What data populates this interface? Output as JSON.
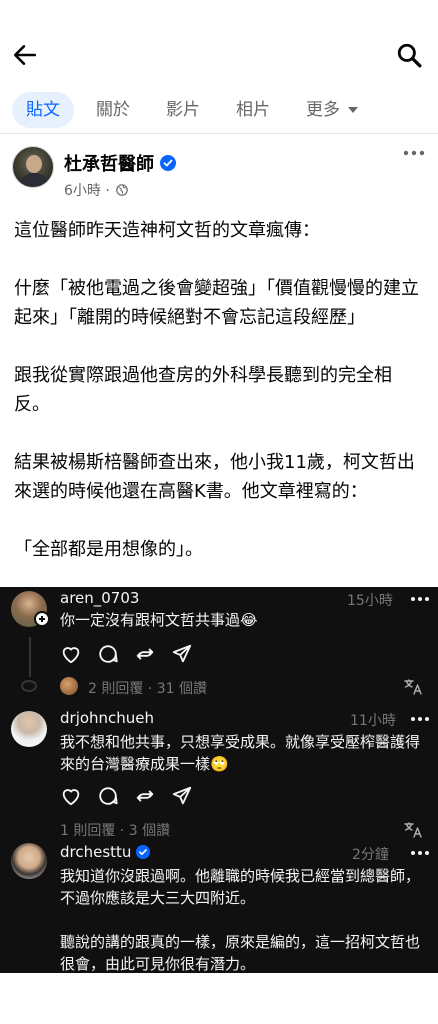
{
  "tabs": [
    {
      "label": "貼文"
    },
    {
      "label": "關於"
    },
    {
      "label": "影片"
    },
    {
      "label": "相片"
    },
    {
      "label": "更多"
    }
  ],
  "post": {
    "author": "杜承哲醫師",
    "time": "6小時 ·",
    "paragraphs": [
      "這位醫師昨天造神柯文哲的文章瘋傳：",
      "什麼「被他電過之後會變超強」「價值觀慢慢的建立起來」「離開的時候絕對不會忘記這段經歷」",
      "跟我從實際跟過他查房的外科學長聽到的完全相反。",
      "結果被楊斯棓醫師查出來，他小我11歲，柯文哲出來選的時候他還在高醫K書。他文章裡寫的：",
      "「全部都是用想像的」。"
    ]
  },
  "embed": {
    "comments": [
      {
        "username": "aren_0703",
        "time": "15小時",
        "text": "你一定沒有跟柯文哲共事過😂",
        "stats": "2 則回覆 · 31 個讚"
      },
      {
        "username": "drjohnchueh",
        "time": "11小時",
        "text": "我不想和他共事，只想享受成果。就像享受壓榨醫護得來的台灣醫療成果一樣🙄",
        "stats": "1 則回覆 · 3 個讚"
      },
      {
        "username": "drchesttu",
        "time": "2分鐘",
        "text_1": "我知道你沒跟過啊。他離職的時候我已經當到總醫師，不過你應該是大三大四附近。",
        "text_2": "聽說的講的跟真的一樣，原來是編的，這一招柯文哲也很會，由此可見你很有潛力。"
      }
    ]
  },
  "colors": {
    "accent": "#0866ff",
    "active_tab_bg": "#e7f0fd",
    "embed_bg": "#101010",
    "muted": "#65676b"
  }
}
